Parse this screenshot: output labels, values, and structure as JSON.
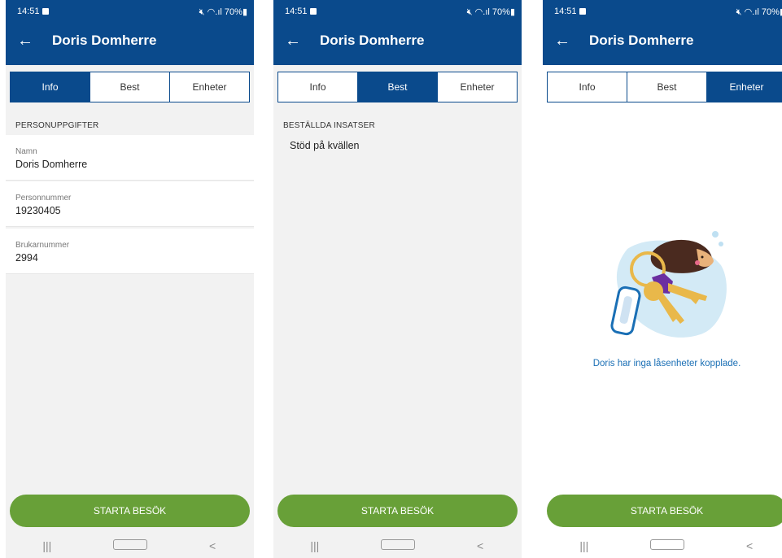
{
  "status": {
    "time": "14:51",
    "battery": "70%"
  },
  "header": {
    "title": "Doris Domherre",
    "back_icon": "arrow-left-icon"
  },
  "tabs": [
    {
      "label": "Info"
    },
    {
      "label": "Best"
    },
    {
      "label": "Enheter"
    }
  ],
  "info": {
    "section_title": "PERSONUPPGIFTER",
    "fields": [
      {
        "label": "Namn",
        "value": "Doris Domherre"
      },
      {
        "label": "Personnummer",
        "value": "19230405"
      },
      {
        "label": "Brukarnummer",
        "value": "2994"
      }
    ]
  },
  "best": {
    "section_title": "BESTÄLLDA INSATSER",
    "items": [
      "Stöd på kvällen"
    ]
  },
  "enheter": {
    "empty_message": "Doris har inga låsenheter kopplade.",
    "illustration": "hedgehog-with-keys-illustration"
  },
  "cta": {
    "label": "STARTA BESÖK"
  },
  "colors": {
    "primary": "#0a4a8c",
    "cta": "#68a038",
    "link": "#1a6fb5"
  }
}
